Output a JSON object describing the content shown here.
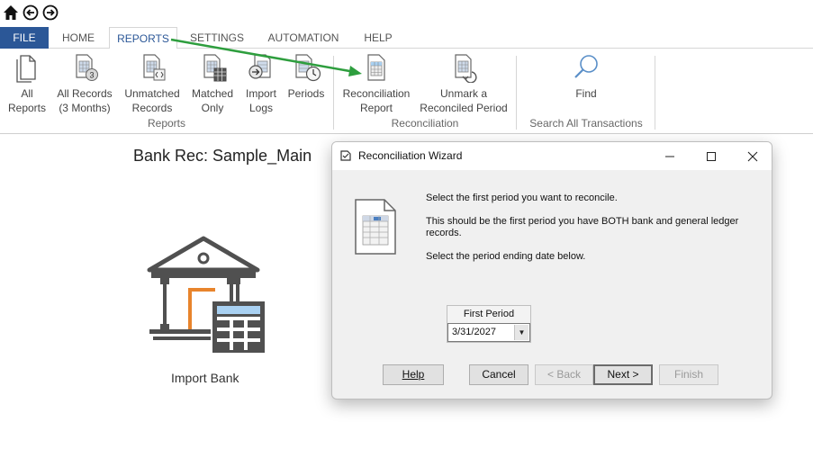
{
  "quickbar": {
    "icons": [
      "home-icon",
      "back-icon",
      "forward-icon"
    ]
  },
  "tabs": [
    {
      "label": "FILE"
    },
    {
      "label": "HOME"
    },
    {
      "label": "REPORTS"
    },
    {
      "label": "SETTINGS"
    },
    {
      "label": "AUTOMATION"
    },
    {
      "label": "HELP"
    }
  ],
  "ribbon": {
    "buttons": [
      {
        "line1": "All",
        "line2": "Reports"
      },
      {
        "line1": "All Records",
        "line2": "(3 Months)"
      },
      {
        "line1": "Unmatched",
        "line2": "Records"
      },
      {
        "line1": "Matched",
        "line2": "Only"
      },
      {
        "line1": "Import",
        "line2": "Logs"
      },
      {
        "line1": "Periods",
        "line2": ""
      },
      {
        "line1": "Reconciliation",
        "line2": "Report"
      },
      {
        "line1": "Unmark a",
        "line2": "Reconciled Period"
      },
      {
        "line1": "Find",
        "line2": ""
      }
    ],
    "groups": {
      "reports": "Reports",
      "reconciliation": "Reconciliation",
      "search": "Search All Transactions"
    }
  },
  "workspace": {
    "title": "Bank Rec: Sample_Main",
    "import_label": "Import Bank"
  },
  "dialog": {
    "title": "Reconciliation Wizard",
    "msg1": "Select the first period you want to reconcile.",
    "msg2": "This should be the first period you have BOTH bank and general ledger records.",
    "msg3": "Select the period ending date below.",
    "field_label": "First Period",
    "field_value": "3/31/2027",
    "buttons": {
      "help": "Help",
      "cancel": "Cancel",
      "back": "< Back",
      "next": "Next >",
      "finish": "Finish"
    }
  },
  "colors": {
    "file_tab": "#2b5797",
    "accent_orange": "#e8842c",
    "annotation_arrow": "#2e9e3e",
    "calendar_blue": "#a9d1f2"
  }
}
